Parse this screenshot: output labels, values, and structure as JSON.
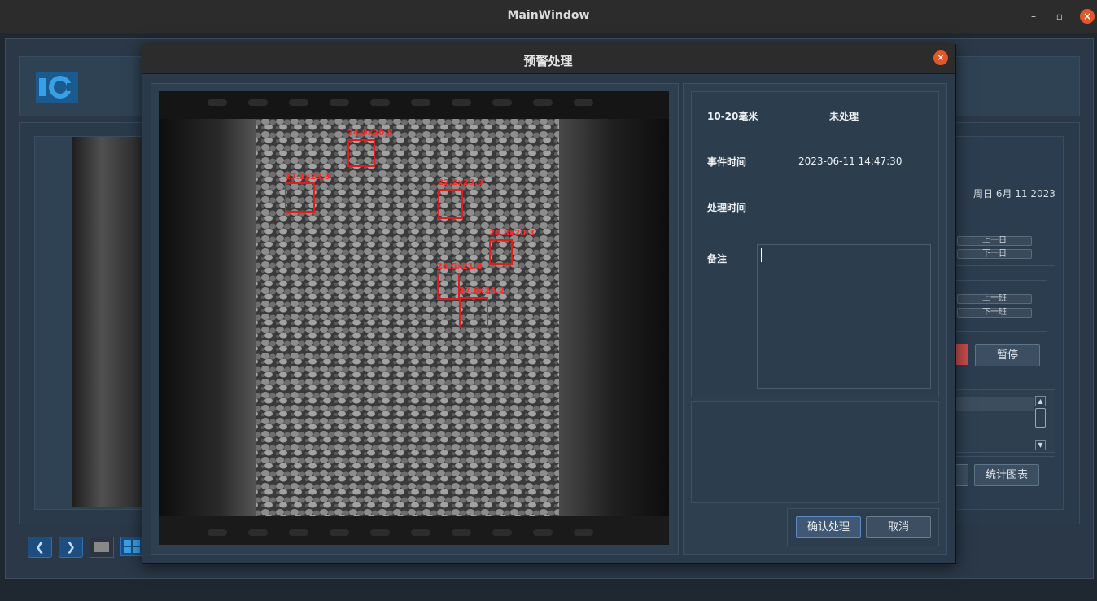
{
  "window": {
    "title": "MainWindow",
    "minimize": "–",
    "maximize": "▫",
    "close": "×"
  },
  "main": {
    "date": "周日 6月 11 2023",
    "prev_day": "上一日",
    "next_day": "下一日",
    "prev_shift": "上一班",
    "next_shift": "下一班",
    "pause": "暂停",
    "stats_chart": "统计图表",
    "nav_prev": "❮",
    "nav_next": "❯"
  },
  "dialog": {
    "title": "预警处理",
    "close": "×",
    "category": "10-20毫米",
    "status": "未处理",
    "event_time_label": "事件时间",
    "event_time_value": "2023-06-11 14:47:30",
    "handle_time_label": "处理时间",
    "handle_time_value": "",
    "notes_label": "备注",
    "notes_value": "",
    "confirm": "确认处理",
    "cancel": "取消"
  },
  "detections": [
    {
      "label": "24.9x20.8"
    },
    {
      "label": "27.1x23.3"
    },
    {
      "label": "22.2x23.9"
    },
    {
      "label": "20.8x20.3"
    },
    {
      "label": "20.5x21.0"
    },
    {
      "label": "27.6x24.2"
    }
  ],
  "colors": {
    "accent_close": "#e3562b",
    "box": "#e21b1b",
    "panel": "#2b3a4b"
  }
}
